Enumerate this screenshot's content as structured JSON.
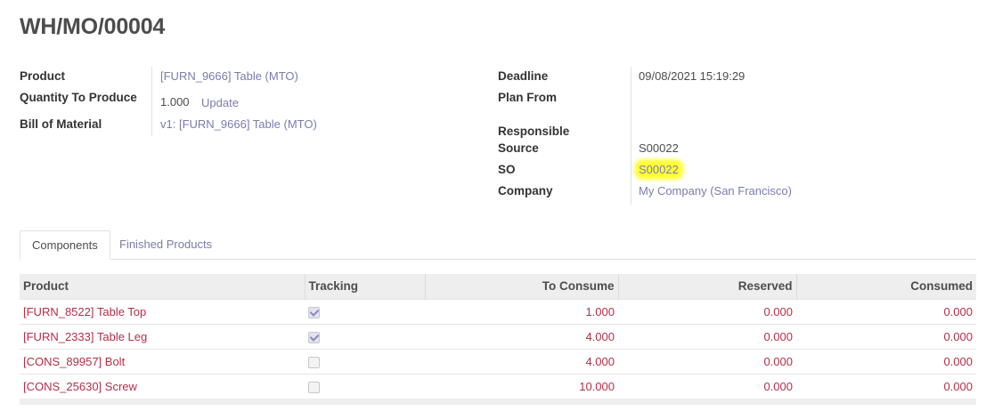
{
  "record": {
    "title": "WH/MO/00004"
  },
  "left_fields": {
    "product_label": "Product",
    "product_value": "[FURN_9666] Table (MTO)",
    "qty_label": "Quantity To Produce",
    "qty_value": "1.000",
    "qty_update": "Update",
    "bom_label": "Bill of Material",
    "bom_value": "v1: [FURN_9666] Table (MTO)"
  },
  "right_fields": {
    "deadline_label": "Deadline",
    "deadline_value": "09/08/2021 15:19:29",
    "plan_from_label": "Plan From",
    "plan_from_value": "",
    "responsible_label": "Responsible",
    "responsible_value": "",
    "source_label": "Source",
    "source_value": "S00022",
    "so_label": "SO",
    "so_value": "S00022",
    "company_label": "Company",
    "company_value": "My Company (San Francisco)"
  },
  "tabs": [
    {
      "label": "Components",
      "active": true
    },
    {
      "label": "Finished Products",
      "active": false
    }
  ],
  "components_table": {
    "headers": [
      "Product",
      "Tracking",
      "To Consume",
      "Reserved",
      "Consumed"
    ],
    "rows": [
      {
        "product": "[FURN_8522] Table Top",
        "tracking": true,
        "to_consume": "1.000",
        "reserved": "0.000",
        "consumed": "0.000"
      },
      {
        "product": "[FURN_2333] Table Leg",
        "tracking": true,
        "to_consume": "4.000",
        "reserved": "0.000",
        "consumed": "0.000"
      },
      {
        "product": "[CONS_89957] Bolt",
        "tracking": false,
        "to_consume": "4.000",
        "reserved": "0.000",
        "consumed": "0.000"
      },
      {
        "product": "[CONS_25630] Screw",
        "tracking": false,
        "to_consume": "10.000",
        "reserved": "0.000",
        "consumed": "0.000"
      }
    ]
  },
  "colors": {
    "link": "#7c7bad",
    "row_text": "#b0304a",
    "highlight": "#ffff3a"
  }
}
